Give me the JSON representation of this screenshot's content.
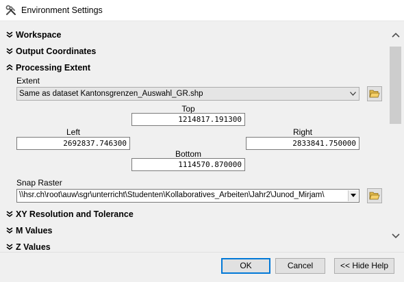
{
  "window": {
    "title": "Environment Settings"
  },
  "sections": {
    "workspace": "Workspace",
    "output_coordinates": "Output Coordinates",
    "processing_extent": "Processing Extent",
    "xy_resolution": "XY Resolution and Tolerance",
    "m_values": "M Values",
    "z_values": "Z Values"
  },
  "extent": {
    "label": "Extent",
    "selected": "Same as dataset Kantonsgrenzen_Auswahl_GR.shp",
    "top_label": "Top",
    "top_value": "1214817.191300",
    "left_label": "Left",
    "left_value": "2692837.746300",
    "right_label": "Right",
    "right_value": "2833841.750000",
    "bottom_label": "Bottom",
    "bottom_value": "1114570.870000"
  },
  "snap_raster": {
    "label": "Snap Raster",
    "value": "\\\\hsr.ch\\root\\auw\\sgr\\unterricht\\Studenten\\Kollaboratives_Arbeiten\\Jahr2\\Junod_Mirjam\\"
  },
  "buttons": {
    "ok": "OK",
    "cancel": "Cancel",
    "hide_help": "<< Hide Help"
  },
  "icons": {
    "app": "tools-icon",
    "folder": "folder-open-icon"
  },
  "colors": {
    "accent": "#0078d7",
    "panel": "#f0f0f0"
  }
}
